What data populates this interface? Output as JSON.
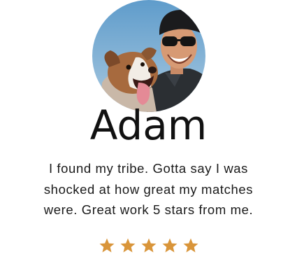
{
  "testimonial": {
    "photo": {
      "icon": "user-avatar-photo",
      "description_hidden": true
    },
    "name": "Adam",
    "review": "I found my tribe. Gotta say I was shocked at how great my matches were. Great work 5 stars from me.",
    "rating": 5,
    "rating_max": 5,
    "star_color": "#D9953A"
  }
}
